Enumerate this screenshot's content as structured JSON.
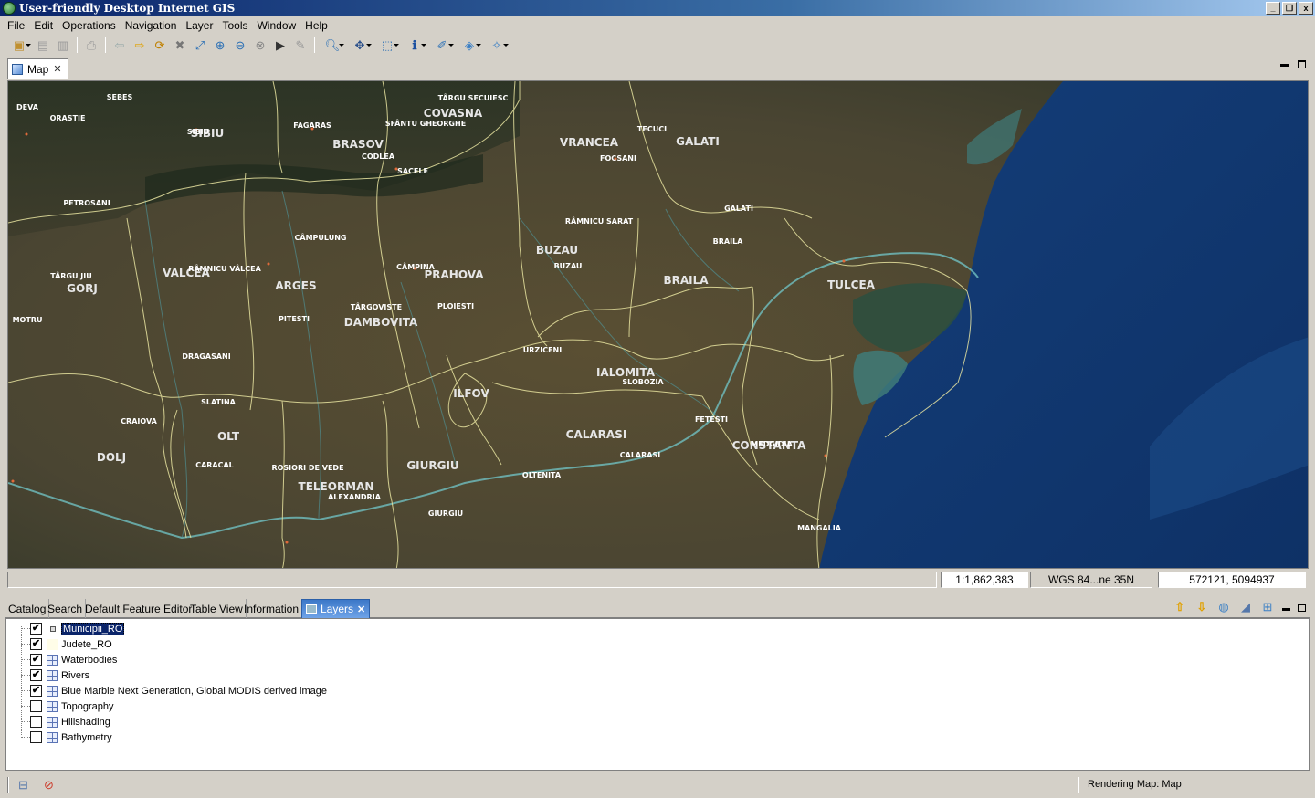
{
  "window": {
    "title": "User-friendly Desktop Internet GIS",
    "minimize": "_",
    "restore": "❐",
    "close": "x"
  },
  "menu": [
    "File",
    "Edit",
    "Operations",
    "Navigation",
    "Layer",
    "Tools",
    "Window",
    "Help"
  ],
  "editor": {
    "tab_label": "Map"
  },
  "map": {
    "counties": [
      {
        "name": "COVASNA"
      },
      {
        "name": "BRASOV"
      },
      {
        "name": "SIBIU"
      },
      {
        "name": "VRANCEA"
      },
      {
        "name": "GALATI"
      },
      {
        "name": "BUZAU"
      },
      {
        "name": "PRAHOVA"
      },
      {
        "name": "VALCEA"
      },
      {
        "name": "GORJ"
      },
      {
        "name": "ARGES"
      },
      {
        "name": "DAMBOVITA"
      },
      {
        "name": "BRAILA"
      },
      {
        "name": "TULCEA"
      },
      {
        "name": "IALOMITA"
      },
      {
        "name": "ILFOV"
      },
      {
        "name": "CALARASI"
      },
      {
        "name": "CONSTANTA"
      },
      {
        "name": "OLT"
      },
      {
        "name": "DOLJ"
      },
      {
        "name": "TELEORMAN"
      },
      {
        "name": "GIURGIU"
      }
    ],
    "cities": [
      {
        "name": "SEBES"
      },
      {
        "name": "DEVA"
      },
      {
        "name": "ORASTIE"
      },
      {
        "name": "SIBIU"
      },
      {
        "name": "FAGARAS"
      },
      {
        "name": "TÂRGU SECUIESC"
      },
      {
        "name": "SFÂNTU GHEORGHE"
      },
      {
        "name": "TECUCI"
      },
      {
        "name": "FOCSANI"
      },
      {
        "name": "CODLEA"
      },
      {
        "name": "SACELE"
      },
      {
        "name": "PETROSANI"
      },
      {
        "name": "GALATI"
      },
      {
        "name": "RÂMNICU SARAT"
      },
      {
        "name": "BRAILA"
      },
      {
        "name": "CÂMPULUNG"
      },
      {
        "name": "TÂRGU JIU"
      },
      {
        "name": "RÂMNICU VÂLCEA"
      },
      {
        "name": "CÂMPINA"
      },
      {
        "name": "BUZAU"
      },
      {
        "name": "TÂRGOVISTE"
      },
      {
        "name": "PLOIESTI"
      },
      {
        "name": "PITESTI"
      },
      {
        "name": "MOTRU"
      },
      {
        "name": "URZICENI"
      },
      {
        "name": "DRAGASANI"
      },
      {
        "name": "SLOBOZIA"
      },
      {
        "name": "SLATINA"
      },
      {
        "name": "CRAIOVA"
      },
      {
        "name": "FETESTI"
      },
      {
        "name": "MEDGIDIA"
      },
      {
        "name": "CALARASI"
      },
      {
        "name": "CARACAL"
      },
      {
        "name": "ROSIORI DE VEDE"
      },
      {
        "name": "OLTENITA"
      },
      {
        "name": "ALEXANDRIA"
      },
      {
        "name": "GIURGIU"
      },
      {
        "name": "MANGALIA"
      }
    ]
  },
  "map_status": {
    "scale": "1:1,862,383",
    "crs": "WGS 84...ne 35N",
    "coords": "572121, 5094937"
  },
  "panel_tabs": [
    "Catalog",
    "Search",
    "Default Feature Editor",
    "Table View",
    "Information",
    "Layers"
  ],
  "layers": [
    {
      "name": "Municipii_RO",
      "checked": true,
      "icon": "point-icon",
      "selected": true
    },
    {
      "name": "Judete_RO",
      "checked": true,
      "icon": "polygon-icon",
      "selected": false
    },
    {
      "name": "Waterbodies",
      "checked": true,
      "icon": "grid-icon",
      "selected": false
    },
    {
      "name": "Rivers",
      "checked": true,
      "icon": "grid-icon",
      "selected": false
    },
    {
      "name": "Blue Marble Next Generation, Global MODIS derived image",
      "checked": true,
      "icon": "grid-icon",
      "selected": false
    },
    {
      "name": "Topography",
      "checked": false,
      "icon": "grid-icon",
      "selected": false
    },
    {
      "name": "Hillshading",
      "checked": false,
      "icon": "grid-icon",
      "selected": false
    },
    {
      "name": "Bathymetry",
      "checked": false,
      "icon": "grid-icon",
      "selected": false
    }
  ],
  "status_bar": {
    "text": "Rendering Map: Map"
  }
}
